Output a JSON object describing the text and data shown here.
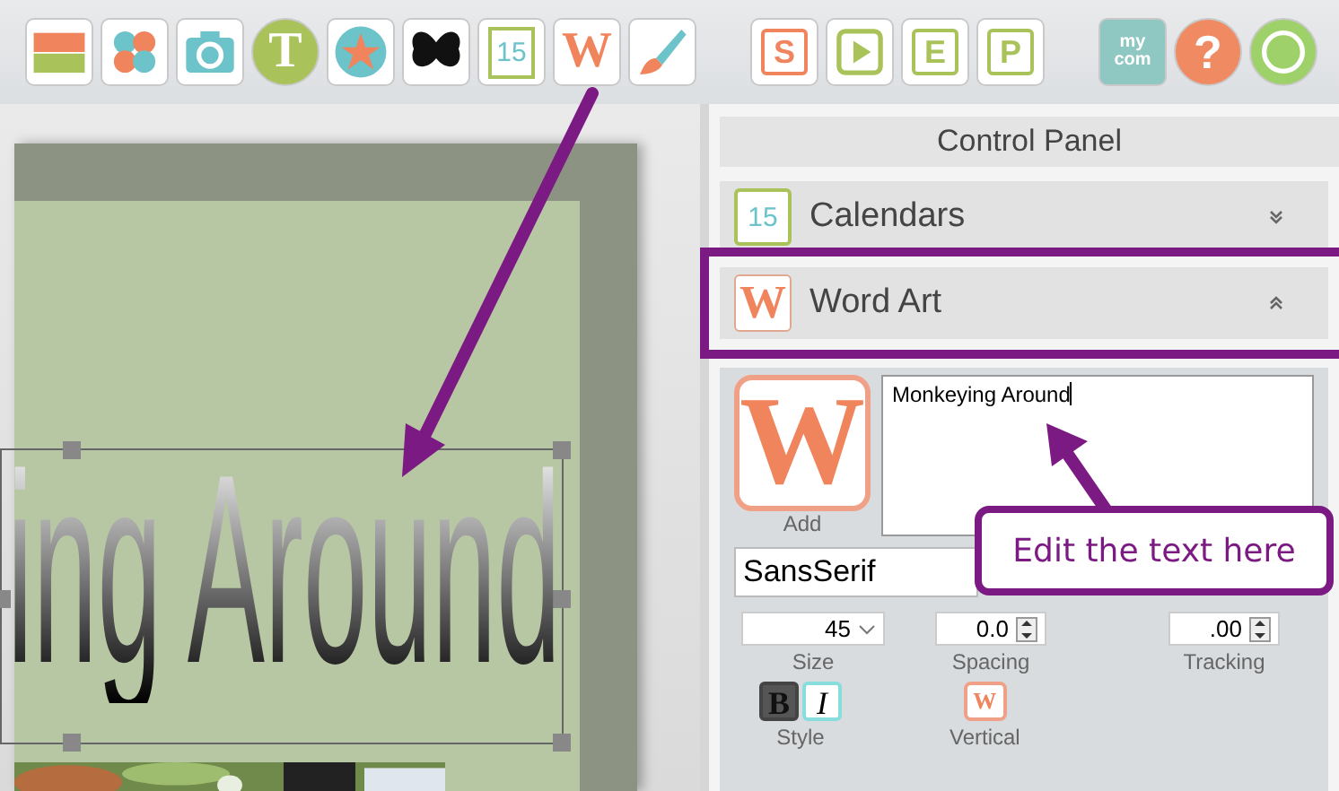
{
  "toolbar": {
    "groups": [
      [
        {
          "kind": "bars"
        },
        {
          "kind": "flower"
        },
        {
          "kind": "camera"
        },
        {
          "kind": "letter-circle",
          "label": "T"
        },
        {
          "kind": "star"
        },
        {
          "kind": "butterfly"
        },
        {
          "kind": "calendar",
          "label": "15"
        },
        {
          "kind": "letter",
          "label": "W"
        },
        {
          "kind": "brush"
        }
      ],
      [
        {
          "kind": "check-letter",
          "label": "S"
        },
        {
          "kind": "play"
        },
        {
          "kind": "page-letter",
          "label": "E"
        },
        {
          "kind": "page-letter",
          "label": "P"
        }
      ],
      [
        {
          "kind": "badge",
          "label": "my com"
        },
        {
          "kind": "help",
          "label": "?"
        },
        {
          "kind": "circle"
        }
      ]
    ]
  },
  "canvas": {
    "word_art_text": "ing Around",
    "selected": true
  },
  "control_panel": {
    "title": "Control Panel",
    "sections": [
      {
        "label": "Calendars",
        "icon_text": "15",
        "kind": "calendar",
        "expanded": false,
        "highlighted": false
      },
      {
        "label": "Word Art",
        "icon_text": "W",
        "kind": "letter",
        "expanded": true,
        "highlighted": true
      }
    ]
  },
  "word_art": {
    "add_icon": "W",
    "add_label": "Add",
    "text": "Monkeying Around",
    "font": "SansSerif",
    "size": {
      "value": "45",
      "label": "Size"
    },
    "spacing": {
      "value": "0.0",
      "label": "Spacing"
    },
    "tracking": {
      "value": ".00",
      "label": "Tracking"
    },
    "style": {
      "label": "Style",
      "bold_glyph": "B",
      "italic_glyph": "I",
      "bold": true,
      "italic": false
    },
    "vertical": {
      "label": "Vertical",
      "icon_text": "W"
    }
  },
  "annotations": {
    "callout": "Edit the text here"
  }
}
